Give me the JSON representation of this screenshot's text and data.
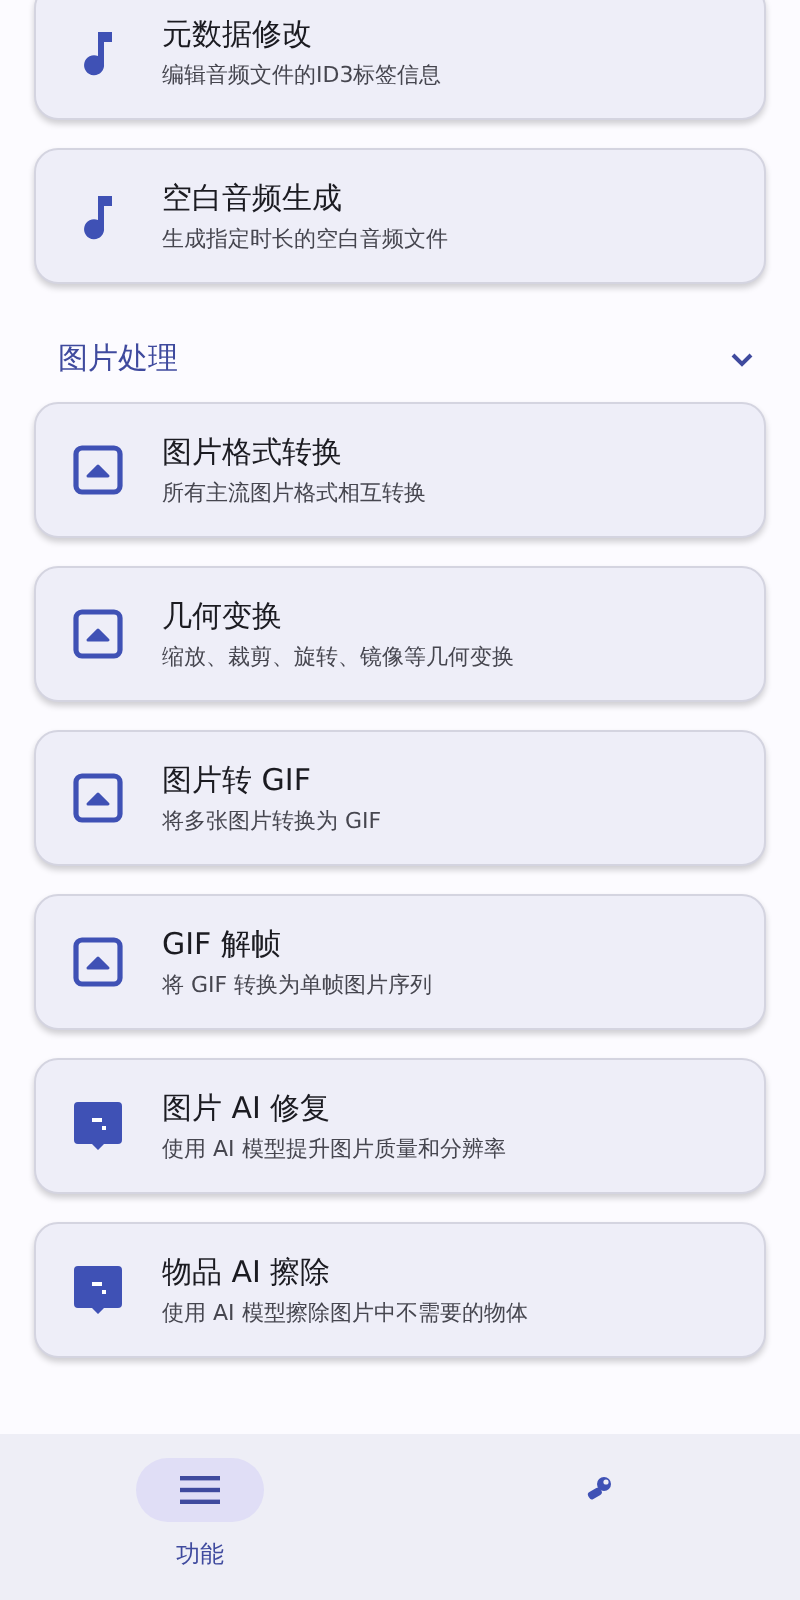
{
  "sections": [
    {
      "items": [
        {
          "kind": "music",
          "title": "元数据修改",
          "subtitle": "编辑音频文件的ID3标签信息"
        },
        {
          "kind": "music",
          "title": "空白音频生成",
          "subtitle": "生成指定时长的空白音频文件"
        }
      ]
    },
    {
      "title": "图片处理",
      "expanded": true,
      "items": [
        {
          "kind": "image",
          "title": "图片格式转换",
          "subtitle": "所有主流图片格式相互转换"
        },
        {
          "kind": "image",
          "title": "几何变换",
          "subtitle": "缩放、裁剪、旋转、镜像等几何变换"
        },
        {
          "kind": "image",
          "title": "图片转 GIF",
          "subtitle": "将多张图片转换为 GIF"
        },
        {
          "kind": "image",
          "title": "GIF 解帧",
          "subtitle": "将 GIF 转换为单帧图片序列"
        },
        {
          "kind": "ai",
          "title": "图片 AI 修复",
          "subtitle": "使用 AI 模型提升图片质量和分辨率"
        },
        {
          "kind": "ai",
          "title": "物品 AI 擦除",
          "subtitle": "使用 AI 模型擦除图片中不需要的物体"
        }
      ]
    }
  ],
  "nav": [
    {
      "kind": "menu",
      "label": "功能",
      "selected": true
    },
    {
      "kind": "tools",
      "selected": false
    }
  ]
}
